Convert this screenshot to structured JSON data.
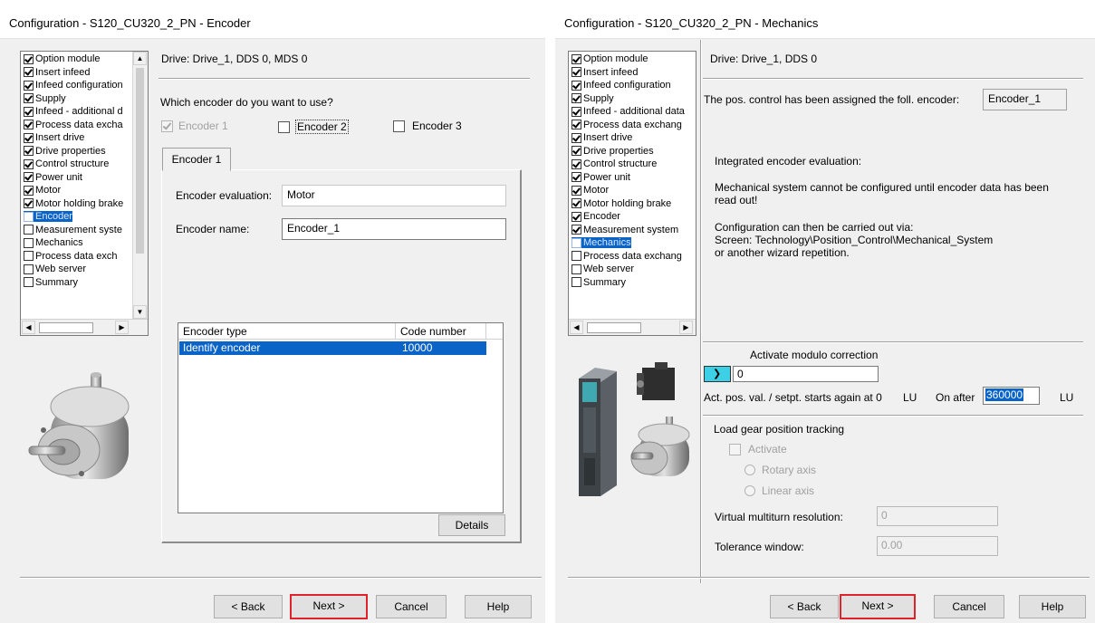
{
  "left": {
    "title": "Configuration - S120_CU320_2_PN - Encoder",
    "drive_info": "Drive: Drive_1, DDS 0, MDS 0",
    "question": "Which encoder do you want to use?",
    "encoders": [
      "Encoder 1",
      "Encoder 2",
      "Encoder 3"
    ],
    "tab": "Encoder 1",
    "eval_label": "Encoder evaluation:",
    "eval_value": "Motor",
    "name_label": "Encoder name:",
    "name_value": "Encoder_1",
    "table_headers": [
      "Encoder type",
      "Code number"
    ],
    "table_row": {
      "type": "Identify encoder",
      "code": "10000"
    },
    "details": "Details",
    "steps": [
      "Option module",
      "Insert infeed",
      "Infeed configuration",
      "Supply",
      "Infeed - additional d",
      "Process data excha",
      "Insert drive",
      "Drive properties",
      "Control structure",
      "Power unit",
      "Motor",
      "Motor holding brake",
      "Encoder",
      "Measurement syste",
      "Mechanics",
      "Process data exch",
      "Web server",
      "Summary"
    ]
  },
  "right": {
    "title": "Configuration - S120_CU320_2_PN - Mechanics",
    "drive_info": "Drive: Drive_1, DDS 0",
    "assigned_label": "The pos. control has been assigned the foll. encoder:",
    "assigned_value": "Encoder_1",
    "info1": "Integrated encoder evaluation:",
    "info2": "Mechanical system cannot be configured until encoder data has been read out!",
    "info3": "Configuration can then be carried out via:",
    "info4": "Screen: Technology\\Position_Control\\Mechanical_System",
    "info5": "or another wizard repetition.",
    "modulo_label": "Activate modulo correction",
    "modulo_value": "0",
    "restart_label": "Act. pos. val. / setpt. starts again at 0",
    "lu1": "LU",
    "on_after": "On after",
    "on_after_value": "360000",
    "lu2": "LU",
    "load_gear": "Load gear position tracking",
    "activate": "Activate",
    "rotary": "Rotary axis",
    "linear": "Linear axis",
    "vmr_label": "Virtual multiturn resolution:",
    "vmr_value": "0",
    "tol_label": "Tolerance window:",
    "tol_value": "0.00",
    "steps": [
      "Option module",
      "Insert infeed",
      "Infeed configuration",
      "Supply",
      "Infeed - additional data",
      "Process data exchang",
      "Insert drive",
      "Drive properties",
      "Control structure",
      "Power unit",
      "Motor",
      "Motor holding brake",
      "Encoder",
      "Measurement system",
      "Mechanics",
      "Process data exchang",
      "Web server",
      "Summary"
    ]
  },
  "buttons": {
    "back": "< Back",
    "next": "Next >",
    "cancel": "Cancel",
    "help": "Help"
  },
  "colors": {
    "selection": "#0a64c8",
    "highlight": "#e0232b",
    "dialog_bg": "#f0f0f0"
  }
}
